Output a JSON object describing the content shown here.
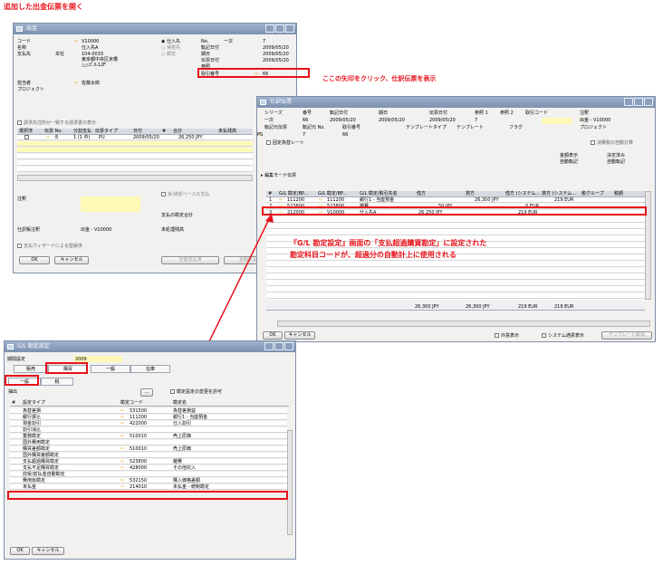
{
  "captions": {
    "top": "追加した出金伝票を開く",
    "arrow_note": "ここの矢印をクリック、仕訳伝票を表示",
    "gl_note_1": "『G/L 勘定設定』画面の「支払超過購買勘定」に設定された",
    "gl_note_2": "勘定科目コードが、超過分の自動計上に使用される"
  },
  "payment": {
    "title": "出金",
    "labels": {
      "code": "コード",
      "name": "名称",
      "payto": "支払先",
      "contact": "担当者",
      "project": "プロジェクト",
      "r1": "仕入先",
      "r2": "得意先",
      "r3": "勘定",
      "no": "No.",
      "date_post": "転記日付",
      "date_due": "期日",
      "date_doc": "伝票日付",
      "ref": "参照",
      "trans_no": "取引番号"
    },
    "values": {
      "code": "V10000",
      "name": "仕入先A",
      "branch": "本社",
      "addr1": "104-0033",
      "addr2": "東京都中央区京橋",
      "addr3": "△△ビル12F",
      "contact": "佐藤太郎",
      "series": "一次",
      "no": "7",
      "date_post": "2009/05/20",
      "date_due": "2009/05/20",
      "date_doc": "2009/05/20",
      "trans_no": "66"
    },
    "pay_on_acc": "請求先住所が一致する請求書の表示",
    "grid_headers": [
      "選択済",
      "伝票 No.",
      "分割支払",
      "伝票タイプ",
      "日付",
      "#",
      "合計",
      "未払残高"
    ],
    "grid_row": {
      "doc": "8",
      "split": "1 (1 中)",
      "type": "PU",
      "date": "2009/05/20",
      "total": "26,250 JPY"
    },
    "remarks": "注釈",
    "on_acc_chk": "掛/通貨ベースの支払",
    "total_lbl": "支払の勘定合計",
    "unpaid_lbl": "未処理残高",
    "journal_lbl": "仕訳帳注釈",
    "journal_val": "出金 - V10000",
    "wizard": "支払ウィザードによる登録済",
    "ok": "OK",
    "cancel": "キャンセル",
    "b1": "全額支払済",
    "b2": "全額支払"
  },
  "journal": {
    "title": "仕訳伝票",
    "h1": [
      "シリーズ",
      "番号",
      "転記日付",
      "期日",
      "伝票日付",
      "参照 1",
      "参照 2",
      "取引コード",
      "注釈"
    ],
    "v1": [
      "一次",
      "66",
      "2009/05/20",
      "2009/05/20",
      "2009/05/20",
      "7",
      "",
      "",
      "出金 - V10000"
    ],
    "h2": [
      "転記元伝票",
      "転記元 No.",
      "取引番号",
      "テンプレートタイプ",
      "テンプレート",
      "フラグ",
      "プロジェクト"
    ],
    "v2": [
      "PS",
      "7",
      "66"
    ],
    "fixed": "固定為替レート",
    "auto_tax": "消費税の自動計算",
    "currency_lbl": "金額表示",
    "currency_val": "自動転記",
    "ref_lbl": "決定済み",
    "ref_val": "自動転記",
    "mode": "編集モード伝票",
    "grid_headers": [
      "#",
      "G/L 勘定/BP...",
      "G/L 勘定/BP...",
      "G/L 勘定/取引先名",
      "借方",
      "貸方",
      "借方 (システム...",
      "貸方 (システム...",
      "税グループ",
      "税額"
    ],
    "rows": [
      [
        "1",
        "111200",
        "111200",
        "銀行1 - 当座預金",
        "",
        "26,300 JPY",
        "",
        "219 EUR"
      ],
      [
        "2",
        "523800",
        "523800",
        "雑費",
        "50 JPY",
        "",
        "0 EUR",
        ""
      ],
      [
        "3",
        "212000",
        "V10000",
        "仕入先A",
        "26,250 JPY",
        "",
        "219 EUR",
        ""
      ]
    ],
    "totals": [
      "26,300 JPY",
      "26,300 JPY",
      "219 EUR",
      "219 EUR"
    ],
    "ok": "OK",
    "cancel": "キャンセル",
    "fx": "外貨表示",
    "sys": "システム通貨表示",
    "tpl": "テンプレート取消"
  },
  "gl": {
    "title": "G/L 勘定設定",
    "period_lbl": "期間設定",
    "period_val": "2009",
    "tabs": [
      "販売",
      "購買",
      "一般",
      "在庫"
    ],
    "subtabs": [
      "一般",
      "税"
    ],
    "filter_lbl": "抽出",
    "filter_chk": "勘定設定の変更を許可",
    "grid_headers": [
      "#",
      "設定タイプ",
      "勘定コード",
      "勘定名"
    ],
    "rows": [
      [
        "為替差損",
        "531500",
        "為替差損益"
      ],
      [
        "銀行振込",
        "111200",
        "銀行1 - 当座預金"
      ],
      [
        "現金割引",
        "422000",
        "仕入割引"
      ],
      [
        "割引消込",
        "",
        ""
      ],
      [
        "業務勘定",
        "510010",
        "売上原価"
      ],
      [
        "国外費用勘定",
        "",
        ""
      ],
      [
        "購買差額勘定",
        "510010",
        "売上原価"
      ],
      [
        "国外購買差額勘定",
        "",
        ""
      ],
      [
        "支払超過購買勘定",
        "523800",
        "雑費"
      ],
      [
        "支払不足購買勘定",
        "428000",
        "その他収入"
      ],
      [
        "前受/前払金自動勘定",
        "",
        ""
      ],
      [
        "費用仮勘定",
        "532150",
        "購入価格差額"
      ],
      [
        "未払金",
        "214010",
        "未払金 - 統制勘定"
      ]
    ],
    "ok": "OK",
    "cancel": "キャンセル"
  },
  "colors": {
    "accent_red": "#e8111a",
    "arrow": "#e8a000",
    "title_bar": "#8a9ebb"
  }
}
